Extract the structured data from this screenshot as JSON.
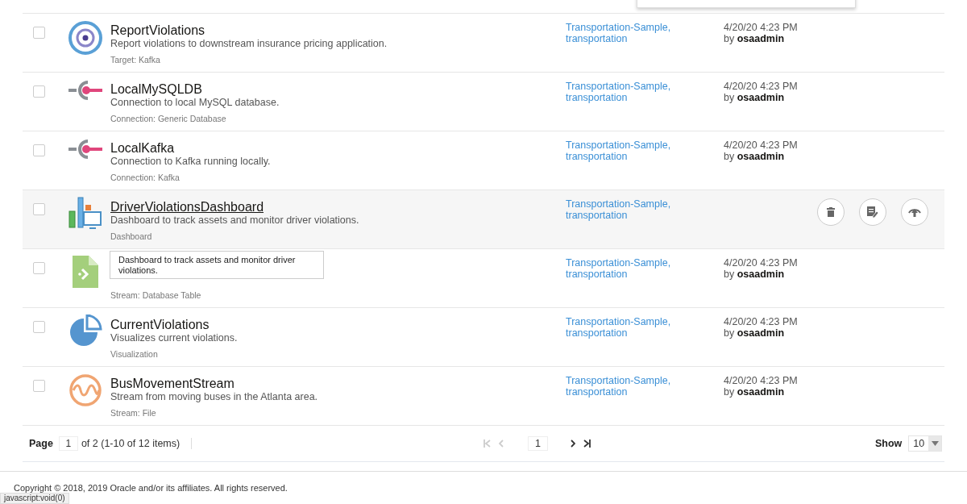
{
  "rows": [
    {
      "kind": "target",
      "checked": false,
      "hovered": false,
      "name": "ReportViolations",
      "description": "Report violations to downstream insurance pricing application.",
      "type": "Target: Kafka",
      "tags": "Transportation-Sample, transportation",
      "date": "4/20/20 4:23 PM",
      "by": "by",
      "user": "osaadmin"
    },
    {
      "kind": "connection",
      "checked": false,
      "hovered": false,
      "name": "LocalMySQLDB",
      "description": "Connection to local MySQL database.",
      "type": "Connection: Generic Database",
      "tags": "Transportation-Sample, transportation",
      "date": "4/20/20 4:23 PM",
      "by": "by",
      "user": "osaadmin"
    },
    {
      "kind": "connection",
      "checked": false,
      "hovered": false,
      "name": "LocalKafka",
      "description": "Connection to Kafka running locally.",
      "type": "Connection: Kafka",
      "tags": "Transportation-Sample, transportation",
      "date": "4/20/20 4:23 PM",
      "by": "by",
      "user": "osaadmin"
    },
    {
      "kind": "dashboard",
      "checked": false,
      "hovered": true,
      "name": "DriverViolationsDashboard",
      "description": "Dashboard to track assets and monitor driver violations.",
      "type": "Dashboard",
      "tags": "Transportation-Sample, transportation"
    },
    {
      "kind": "stream-table",
      "checked": false,
      "hovered": false,
      "type": "Stream: Database Table",
      "tags": "Transportation-Sample, transportation",
      "date": "4/20/20 4:23 PM",
      "by": "by",
      "user": "osaadmin"
    },
    {
      "kind": "visualization",
      "checked": false,
      "hovered": false,
      "name": "CurrentViolations",
      "description": "Visualizes current violations.",
      "type": "Visualization",
      "tags": "Transportation-Sample, transportation",
      "date": "4/20/20 4:23 PM",
      "by": "by",
      "user": "osaadmin"
    },
    {
      "kind": "stream-file",
      "checked": false,
      "hovered": false,
      "name": "BusMovementStream",
      "description": "Stream from moving buses in the Atlanta area.",
      "type": "Stream: File",
      "tags": "Transportation-Sample, transportation",
      "date": "4/20/20 4:23 PM",
      "by": "by",
      "user": "osaadmin"
    }
  ],
  "tooltip": {
    "text": "Dashboard to track assets and monitor driver violations."
  },
  "pagination": {
    "page_label": "Page",
    "page_value": "1",
    "page_info": "of 2 (1-10 of 12 items)",
    "first_disabled": true,
    "prev_disabled": true,
    "current_page": "1",
    "next_disabled": false,
    "last_disabled": false,
    "show_label": "Show",
    "show_value": "10"
  },
  "footer": {
    "copyright": "Copyright © 2018, 2019 Oracle and/or its affiliates. All rights reserved."
  },
  "status_bar": {
    "url": "javascript:void(0)"
  }
}
